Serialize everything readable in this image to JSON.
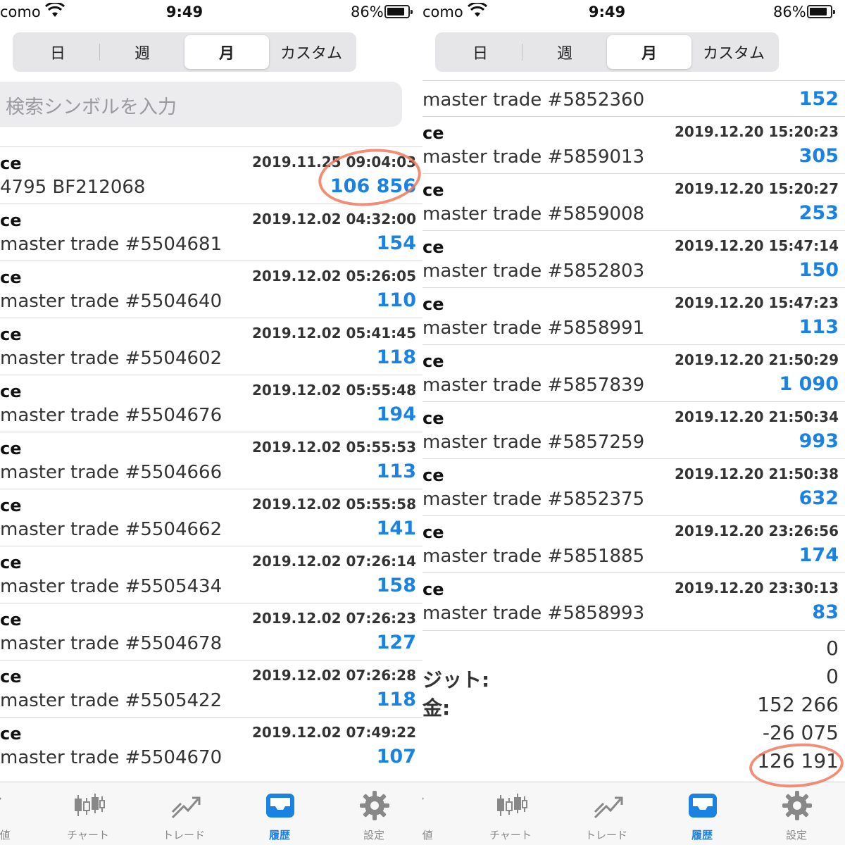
{
  "status": {
    "carrier": "como",
    "time": "9:49",
    "battery": "86%"
  },
  "segments": [
    "日",
    "週",
    "月",
    "カスタム"
  ],
  "search_placeholder": "検索シンボルを入力",
  "left_rows": [
    {
      "type": "ce",
      "date": "2019.11.25 09:04:03",
      "comment": "4795 BF212068",
      "profit": "106 856"
    },
    {
      "type": "ce",
      "date": "2019.12.02 04:32:00",
      "comment": "master trade #5504681",
      "profit": "154"
    },
    {
      "type": "ce",
      "date": "2019.12.02 05:26:05",
      "comment": "master trade #5504640",
      "profit": "110"
    },
    {
      "type": "ce",
      "date": "2019.12.02 05:41:45",
      "comment": "master trade #5504602",
      "profit": "118"
    },
    {
      "type": "ce",
      "date": "2019.12.02 05:55:48",
      "comment": "master trade #5504676",
      "profit": "194"
    },
    {
      "type": "ce",
      "date": "2019.12.02 05:55:53",
      "comment": "master trade #5504666",
      "profit": "113"
    },
    {
      "type": "ce",
      "date": "2019.12.02 05:55:58",
      "comment": "master trade #5504662",
      "profit": "141"
    },
    {
      "type": "ce",
      "date": "2019.12.02 07:26:14",
      "comment": "master trade #5505434",
      "profit": "158"
    },
    {
      "type": "ce",
      "date": "2019.12.02 07:26:23",
      "comment": "master trade #5504678",
      "profit": "127"
    },
    {
      "type": "ce",
      "date": "2019.12.02 07:26:28",
      "comment": "master trade #5505422",
      "profit": "118"
    },
    {
      "type": "ce",
      "date": "2019.12.02 07:49:22",
      "comment": "master trade #5504670",
      "profit": "107"
    }
  ],
  "right_first_row": {
    "comment": "master trade #5852360",
    "profit": "152"
  },
  "right_rows": [
    {
      "type": "ce",
      "date": "2019.12.20 15:20:23",
      "comment": "master trade #5859013",
      "profit": "305"
    },
    {
      "type": "ce",
      "date": "2019.12.20 15:20:27",
      "comment": "master trade #5859008",
      "profit": "253"
    },
    {
      "type": "ce",
      "date": "2019.12.20 15:47:14",
      "comment": "master trade #5852803",
      "profit": "150"
    },
    {
      "type": "ce",
      "date": "2019.12.20 15:47:23",
      "comment": "master trade #5858991",
      "profit": "113"
    },
    {
      "type": "ce",
      "date": "2019.12.20 21:50:29",
      "comment": "master trade #5857839",
      "profit": "1 090"
    },
    {
      "type": "ce",
      "date": "2019.12.20 21:50:34",
      "comment": "master trade #5857259",
      "profit": "993"
    },
    {
      "type": "ce",
      "date": "2019.12.20 21:50:38",
      "comment": "master trade #5852375",
      "profit": "632"
    },
    {
      "type": "ce",
      "date": "2019.12.20 23:26:56",
      "comment": "master trade #5851885",
      "profit": "174"
    },
    {
      "type": "ce",
      "date": "2019.12.20 23:30:13",
      "comment": "master trade #5858993",
      "profit": "83"
    }
  ],
  "summary": [
    {
      "label": "",
      "value": "0"
    },
    {
      "label": "ジット:",
      "value": "0"
    },
    {
      "label": "金:",
      "value": "152 266"
    },
    {
      "label": "",
      "value": "-26 075"
    },
    {
      "label": "",
      "value": "126 191"
    }
  ],
  "tabs": [
    {
      "label": "値",
      "icon": "quotes-icon",
      "active": false
    },
    {
      "label": "チャート",
      "icon": "chart-icon",
      "active": false
    },
    {
      "label": "トレード",
      "icon": "trade-icon",
      "active": false
    },
    {
      "label": "履歴",
      "icon": "history-icon",
      "active": true
    },
    {
      "label": "設定",
      "icon": "settings-icon",
      "active": false
    }
  ],
  "colors": {
    "profit": "#1a82e2",
    "highlight_circle": "#f07a5f",
    "active_tab": "#1a82e2"
  }
}
